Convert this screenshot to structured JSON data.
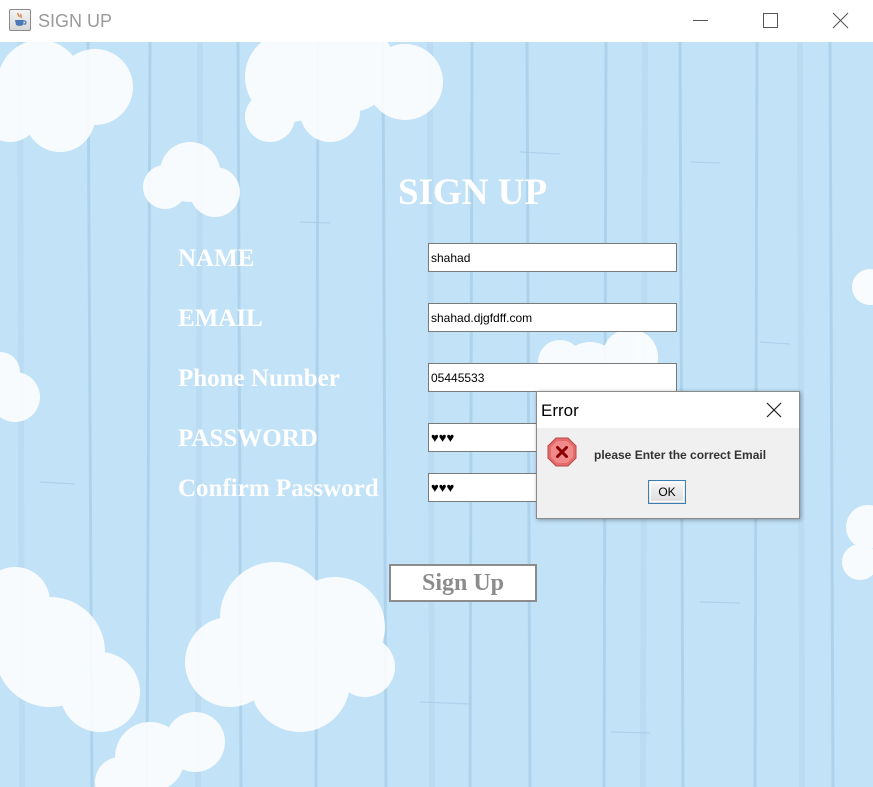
{
  "window": {
    "title": "SIGN UP",
    "app_icon": "java-coffee-cup-icon",
    "controls": [
      "minimize-icon",
      "maximize-icon",
      "close-icon"
    ]
  },
  "form": {
    "title": "SIGN UP",
    "fields": [
      {
        "label": "NAME",
        "value": "shahad"
      },
      {
        "label": "EMAIL",
        "value": "shahad.djgfdff.com"
      },
      {
        "label": "Phone Number",
        "value": "05445533"
      },
      {
        "label": "PASSWORD",
        "value": "♥♥♥"
      },
      {
        "label": "Confirm Password",
        "value": "♥♥♥"
      }
    ],
    "submit_label": "Sign Up"
  },
  "error_dialog": {
    "title": "Error",
    "icon": "error-x-icon",
    "message": "please Enter the correct Email",
    "ok_label": "OK"
  },
  "colors": {
    "background": "#bfe0f6",
    "label_text": "#ffffff",
    "button_text": "#8c8c8c",
    "error_icon": "#e04545"
  }
}
